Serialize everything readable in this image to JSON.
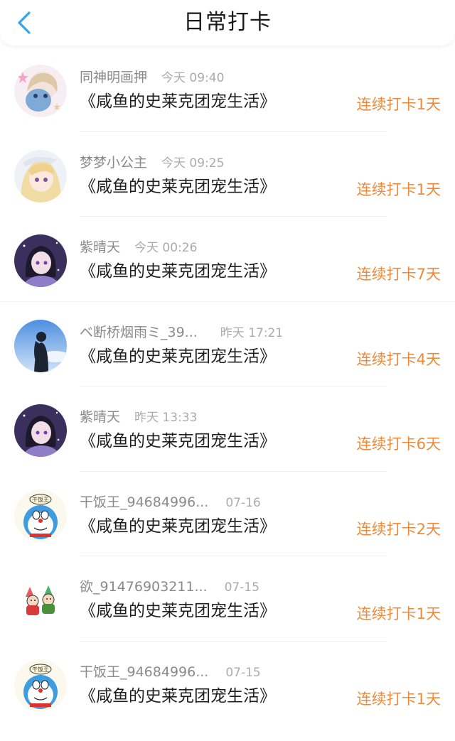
{
  "header": {
    "title": "日常打卡",
    "back_icon": "chevron-left-icon",
    "accent": "#2ea6f0"
  },
  "colors": {
    "streak": "#ef8a3a",
    "name": "#8a8a8a",
    "time": "#ababab"
  },
  "entries": [
    {
      "name": "同神明画押",
      "time": "今天 09:40",
      "book": "《咸鱼的史莱克团宠生活》",
      "streak": "连续打卡1天",
      "avatar": "anime-girl-stars-avatar"
    },
    {
      "name": "梦梦小公主",
      "time": "今天 09:25",
      "book": "《咸鱼的史莱克团宠生活》",
      "streak": "连续打卡1天",
      "avatar": "blonde-anime-girl-avatar"
    },
    {
      "name": "紫晴天",
      "time": "今天 00:26",
      "book": "《咸鱼的史莱克团宠生活》",
      "streak": "连续打卡7天",
      "avatar": "purple-anime-girl-avatar"
    },
    {
      "name": "ベ断桥烟雨ミ_39...",
      "time": "昨天 17:21",
      "book": "《咸鱼的史莱克团宠生活》",
      "streak": "连续打卡4天",
      "avatar": "sky-silhouette-avatar"
    },
    {
      "name": "紫晴天",
      "time": "昨天 13:33",
      "book": "《咸鱼的史莱克团宠生活》",
      "streak": "连续打卡6天",
      "avatar": "purple-anime-girl-avatar"
    },
    {
      "name": "干饭王_94684996...",
      "time": "07-16",
      "book": "《咸鱼的史莱克团宠生活》",
      "streak": "连续打卡2天",
      "avatar": "doraemon-avatar",
      "avatar_text": "干饭王"
    },
    {
      "name": "欲_91476903211...",
      "time": "07-15",
      "book": "《咸鱼的史莱克团宠生活》",
      "streak": "连续打卡1天",
      "avatar": "two-kids-cartoon-avatar"
    },
    {
      "name": "干饭王_94684996...",
      "time": "07-15",
      "book": "《咸鱼的史莱克团宠生活》",
      "streak": "连续打卡1天",
      "avatar": "doraemon-avatar",
      "avatar_text": "干饭王"
    }
  ]
}
